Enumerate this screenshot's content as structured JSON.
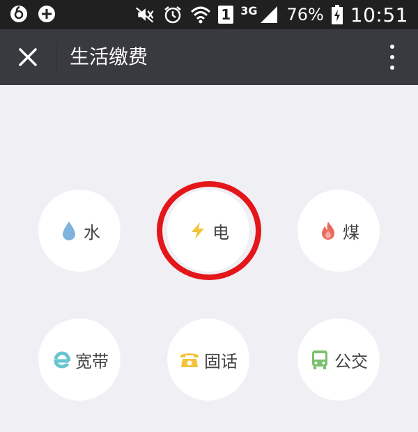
{
  "status_bar": {
    "signal_type": "3G",
    "sim_badge": "1",
    "battery": "76%",
    "time": "10:51"
  },
  "nav": {
    "title": "生活缴费"
  },
  "services": [
    {
      "id": "water",
      "label": "水",
      "icon": "water-drop-icon",
      "color": "#7fb3dc"
    },
    {
      "id": "electricity",
      "label": "电",
      "icon": "lightning-icon",
      "color": "#f2c43a"
    },
    {
      "id": "gas",
      "label": "煤",
      "icon": "flame-icon",
      "color": "#ec6a5c"
    },
    {
      "id": "broadband",
      "label": "宽带",
      "icon": "browser-e-icon",
      "color": "#68c4cf"
    },
    {
      "id": "landline",
      "label": "固话",
      "icon": "telephone-icon",
      "color": "#f2c43a"
    },
    {
      "id": "bus",
      "label": "公交",
      "icon": "bus-icon",
      "color": "#7ac16c"
    }
  ],
  "highlight": {
    "target": "electricity",
    "color": "#e3161a"
  }
}
